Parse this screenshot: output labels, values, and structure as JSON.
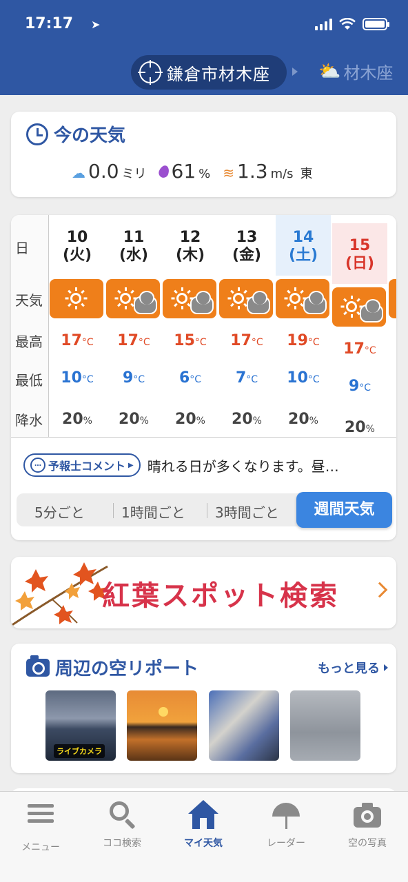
{
  "status_bar": {
    "time": "17:17"
  },
  "header": {
    "location": "鎌倉市材木座",
    "next_location": "材木座"
  },
  "now": {
    "title": "今の天気",
    "precip_value": "0.0",
    "precip_unit": "ミリ",
    "humidity_value": "61",
    "humidity_unit": "%",
    "wind_value": "1.3",
    "wind_unit": "m/s",
    "wind_dir": "東"
  },
  "week": {
    "row_labels": {
      "day": "日",
      "weather": "天気",
      "high": "最高",
      "low": "最低",
      "rain": "降水"
    },
    "temp_unit": "°C",
    "rain_unit": "%",
    "days": [
      {
        "date": "10",
        "dow": "(火)",
        "weather": "sunny",
        "high": "17",
        "low": "10",
        "rain": "20"
      },
      {
        "date": "11",
        "dow": "(水)",
        "weather": "sunny-cloudy",
        "high": "17",
        "low": "9",
        "rain": "20"
      },
      {
        "date": "12",
        "dow": "(木)",
        "weather": "sunny-cloudy",
        "high": "15",
        "low": "6",
        "rain": "20"
      },
      {
        "date": "13",
        "dow": "(金)",
        "weather": "sunny-cloudy",
        "high": "17",
        "low": "7",
        "rain": "20"
      },
      {
        "date": "14",
        "dow": "(土)",
        "weather": "sunny-cloudy",
        "high": "19",
        "low": "10",
        "rain": "20"
      },
      {
        "date": "15",
        "dow": "(日)",
        "weather": "sunny-cloudy",
        "high": "17",
        "low": "9",
        "rain": "20"
      }
    ],
    "comment_badge": "予報士コメント",
    "comment_text": "晴れる日が多くなります。昼…",
    "tabs": [
      "5分ごと",
      "1時間ごと",
      "3時間ごと"
    ],
    "active_tab": "週間天気"
  },
  "koyo": {
    "label": "紅葉スポット検索"
  },
  "sky": {
    "title": "周辺の空リポート",
    "more": "もっと見る",
    "live_label": "ライブカメラ"
  },
  "tabbar": {
    "items": [
      {
        "label": "メニュー",
        "icon": "menu-icon"
      },
      {
        "label": "ココ検索",
        "icon": "search-icon"
      },
      {
        "label": "マイ天気",
        "icon": "home-icon"
      },
      {
        "label": "レーダー",
        "icon": "umbrella-icon"
      },
      {
        "label": "空の写真",
        "icon": "camera-icon"
      }
    ]
  },
  "colors": {
    "brand_blue": "#2f57a3",
    "orange": "#ef7f1a",
    "high_red": "#e04a26",
    "low_blue": "#2a73d2"
  }
}
